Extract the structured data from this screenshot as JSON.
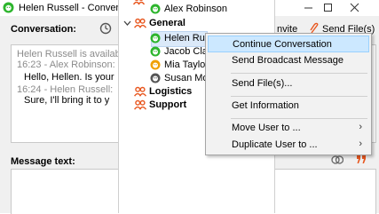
{
  "window": {
    "title": "Helen Russell - Conver"
  },
  "toolbar": {
    "conversation_label": "Conversation:",
    "invite_label": "nvite",
    "send_file_label": "Send File(s)"
  },
  "conversation": {
    "lines": [
      "Helen Russell is availab",
      "16:23 - Alex Robinson:",
      "Hello, Hellen. Is your",
      "16:24 - Helen Russell:",
      "Sure,  I'll bring it to y"
    ]
  },
  "message": {
    "label": "Message text:"
  },
  "contacts": {
    "partial_top": "Alex Robinson",
    "groups": [
      {
        "name": "General",
        "members": [
          "Helen Rus",
          "Jacob Clar",
          "Mia Taylor",
          "Susan Mo"
        ]
      },
      {
        "name": "Logistics"
      },
      {
        "name": "Support"
      }
    ]
  },
  "context_menu": {
    "items": [
      {
        "label": "Continue Conversation",
        "highlighted": true
      },
      {
        "label": "Send Broadcast Message"
      },
      {
        "label": "Send File(s)..."
      },
      {
        "label": "Get Information"
      },
      {
        "label": "Move User to ...",
        "submenu": true
      },
      {
        "label": "Duplicate User to ...",
        "submenu": true
      }
    ],
    "submenu_arrow": "›"
  },
  "colors": {
    "online": "#2db52d",
    "away": "#f0a000",
    "offline": "#555555",
    "group_icon": "#e8571f",
    "highlight": "#cce8ff"
  }
}
